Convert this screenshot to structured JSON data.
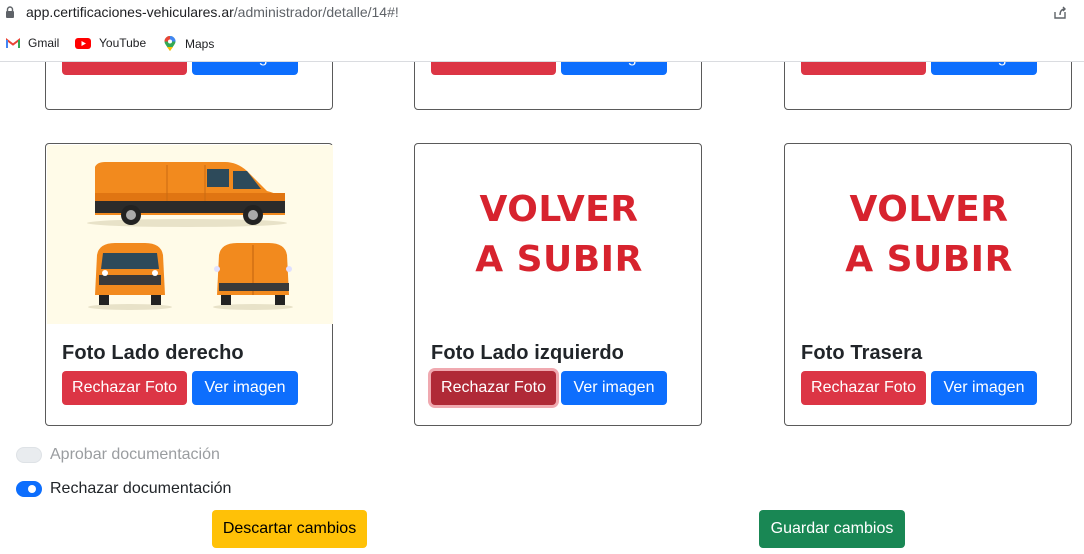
{
  "browser": {
    "url_host": "app.certificaciones-vehiculares.ar",
    "url_path": "/administrador/detalle/14#!",
    "bookmarks": [
      {
        "label": "Gmail",
        "icon": "gmail-icon"
      },
      {
        "label": "YouTube",
        "icon": "youtube-icon"
      },
      {
        "label": "Maps",
        "icon": "maps-icon"
      }
    ]
  },
  "top_row": [
    {
      "reject_label": "Rechazar Foto",
      "view_label": "Ver imagen"
    },
    {
      "reject_label": "Rechazar Foto",
      "view_label": "Ver imagen"
    },
    {
      "reject_label": "Rechazar Foto",
      "view_label": "Ver imagen"
    }
  ],
  "photos": [
    {
      "title": "Foto Lado derecho",
      "image": "van-illustration",
      "reject_label": "Rechazar Foto",
      "view_label": "Ver imagen"
    },
    {
      "title": "Foto Lado izquierdo",
      "image_text_1": "VOLVER",
      "image_text_2": "A SUBIR",
      "reject_label": "Rechazar Foto",
      "view_label": "Ver imagen"
    },
    {
      "title": "Foto Trasera",
      "image_text_1": "VOLVER",
      "image_text_2": "A SUBIR",
      "reject_label": "Rechazar Foto",
      "view_label": "Ver imagen"
    }
  ],
  "options": {
    "approve_label": "Aprobar documentación",
    "approve_checked": false,
    "reject_label": "Rechazar documentación",
    "reject_checked": true
  },
  "actions": {
    "discard_label": "Descartar cambios",
    "save_label": "Guardar cambios"
  },
  "colors": {
    "danger": "#dc3545",
    "primary": "#0d6efd",
    "warning": "#ffc107",
    "success": "#198754",
    "volver_red": "#d7232e"
  }
}
